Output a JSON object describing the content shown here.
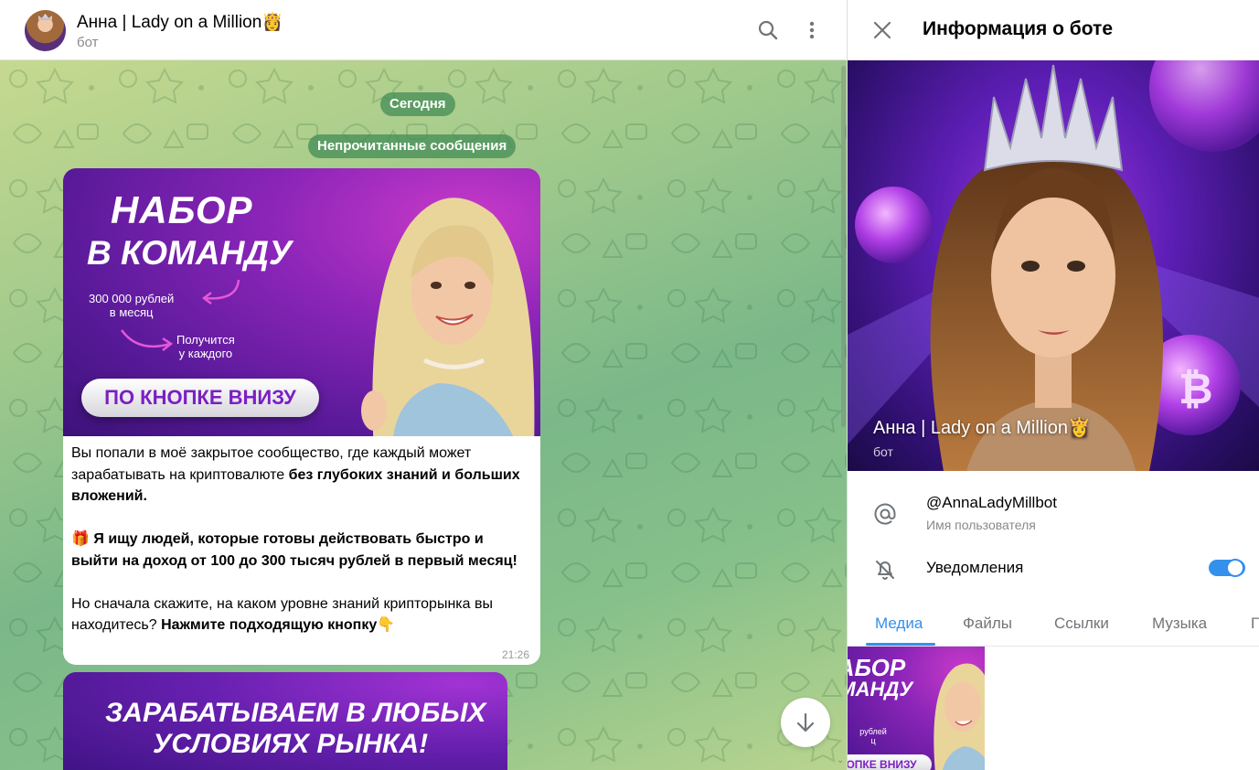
{
  "chat": {
    "title": "Анна | Lady on a Million👸",
    "subtitle": "бот"
  },
  "service": {
    "today": "Сегодня",
    "unread": "Непрочитанные сообщения"
  },
  "message1": {
    "promo": {
      "line1": "НАБОР",
      "line2": "В КОМАНДУ",
      "note1": "300 000 рублей\nв месяц",
      "note2": "Получится\nу каждого",
      "cta": "ПО КНОПКЕ ВНИЗУ"
    },
    "p1_plain": "Вы попали в моё закрытое сообщество, где каждый может зарабатывать на криптовалюте ",
    "p1_bold": "без глубоких знаний и больших вложений.",
    "p2_emoji": "🎁",
    "p2_bold": " Я ищу людей, которые готовы действовать быстро и выйти на доход от 100 до 300 тысяч рублей в первый месяц!",
    "p3_plain": "Но сначала скажите, на каком уровне знаний крипторынка вы находитесь? ",
    "p3_bold": "Нажмите подходящую кнопку👇",
    "time": "21:26"
  },
  "message2": {
    "line1": "ЗАРАБАТЫВАЕМ В ЛЮБЫХ",
    "line2": "УСЛОВИЯХ РЫНКА!"
  },
  "info": {
    "title": "Информация о боте",
    "hero_name": "Анна | Lady on a Million👸",
    "hero_sub": "бот",
    "username": "@AnnaLadyMillbot",
    "username_label": "Имя пользователя",
    "notifications": "Уведомления",
    "notifications_on": true
  },
  "tabs": [
    {
      "label": "Медиа",
      "active": true
    },
    {
      "label": "Файлы",
      "active": false
    },
    {
      "label": "Ссылки",
      "active": false
    },
    {
      "label": "Музыка",
      "active": false
    },
    {
      "label": "Г",
      "active": false
    }
  ],
  "thumb": {
    "line1": "НАБОР",
    "line2": "КОМАНДУ",
    "note": "рублей\nц\n\nПолучится\nу каждого",
    "cta": "ОПКЕ ВНИЗУ"
  },
  "colors": {
    "accent": "#3390ec",
    "pill": "#438c56",
    "promo_purple": "#8b25b8"
  }
}
